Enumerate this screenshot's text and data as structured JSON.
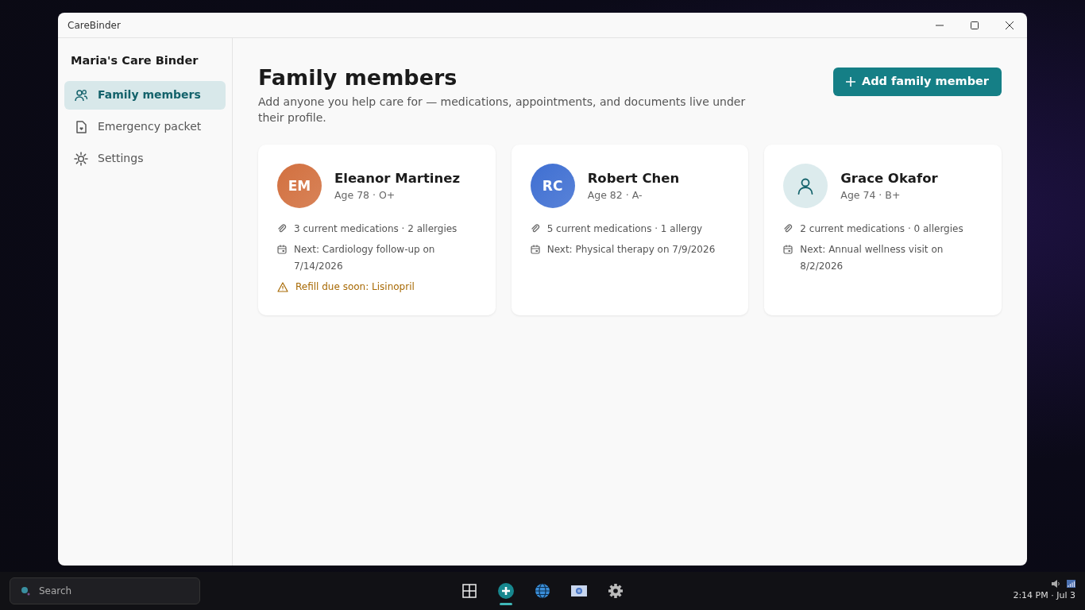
{
  "window": {
    "title": "CareBinder"
  },
  "sidebar": {
    "title": "Maria's Care Binder",
    "items": [
      {
        "label": "Family members",
        "kind": "people",
        "selected": true
      },
      {
        "label": "Emergency packet",
        "kind": "document",
        "selected": false
      },
      {
        "label": "Settings",
        "kind": "settings",
        "selected": false
      }
    ]
  },
  "header": {
    "title": "Family members",
    "subtitle": "Add anyone you help care for — medications, appointments, and documents live under their profile.",
    "add_button": "Add family member"
  },
  "members": [
    {
      "name": "Eleanor Martinez",
      "details": "Age 78 · O+",
      "avatar": {
        "kind": "initials",
        "initials": "EM",
        "color": "#d2703f"
      },
      "lines": [
        {
          "kind": "meds",
          "text": "3 current medications · 2 allergies"
        },
        {
          "kind": "appointment",
          "text": "Next: Cardiology follow-up on 7/14/2026"
        },
        {
          "kind": "warning",
          "text": "Refill due soon: Lisinopril"
        }
      ]
    },
    {
      "name": "Robert Chen",
      "details": "Age 82 · A-",
      "avatar": {
        "kind": "initials",
        "initials": "RC",
        "color": "#3f6fd2"
      },
      "lines": [
        {
          "kind": "meds",
          "text": "5 current medications · 1 allergy"
        },
        {
          "kind": "appointment",
          "text": "Next: Physical therapy on 7/9/2026"
        }
      ]
    },
    {
      "name": "Grace Okafor",
      "details": "Age 74 · B+",
      "avatar": {
        "kind": "icon",
        "color": "#dcebed"
      },
      "lines": [
        {
          "kind": "meds",
          "text": "2 current medications · 0 allergies"
        },
        {
          "kind": "appointment",
          "text": "Next: Annual wellness visit on 8/2/2026"
        }
      ]
    }
  ],
  "taskbar": {
    "search_placeholder": "Search",
    "apps": [
      {
        "kind": "start",
        "selected": false
      },
      {
        "kind": "carebinder",
        "selected": true
      },
      {
        "kind": "browser",
        "selected": false
      },
      {
        "kind": "photos",
        "selected": false
      },
      {
        "kind": "settings",
        "selected": false
      }
    ],
    "clock": "2:14 PM · Jul 3"
  }
}
